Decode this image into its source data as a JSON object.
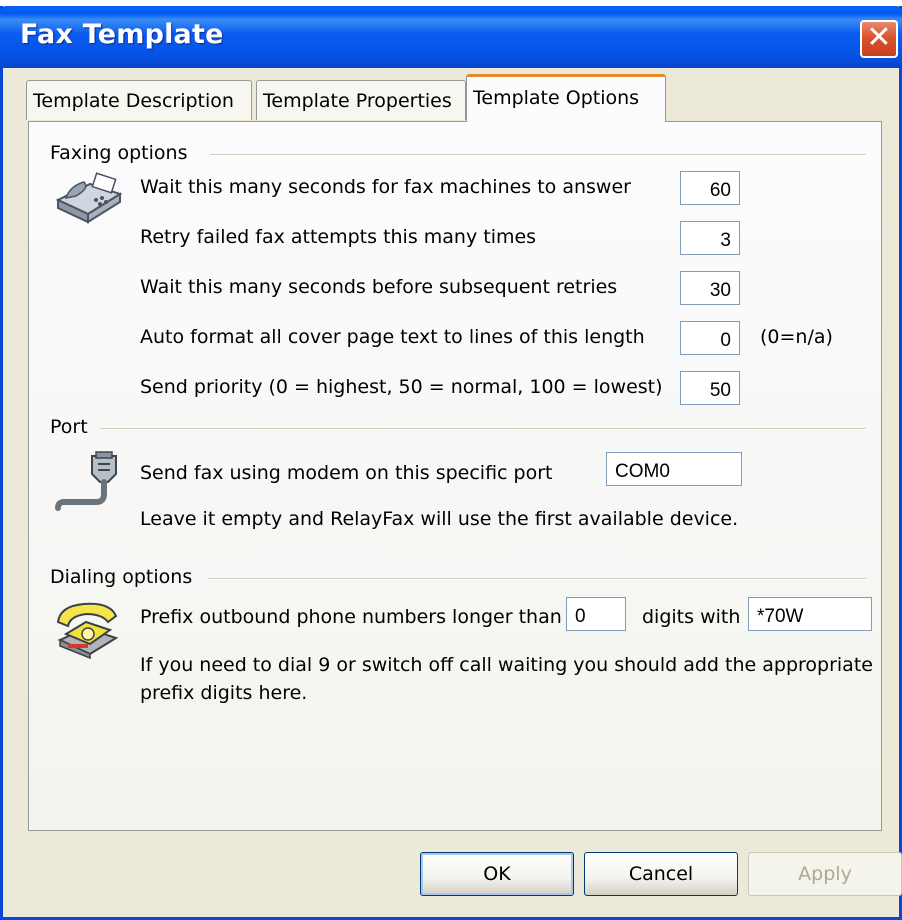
{
  "window": {
    "title": "Fax Template",
    "close_symbol": "✕"
  },
  "tabs": [
    {
      "label": "Template Description",
      "active": false
    },
    {
      "label": "Template Properties",
      "active": false
    },
    {
      "label": "Template Options",
      "active": true
    }
  ],
  "faxing": {
    "title": "Faxing options",
    "icon": "fax-machine-icon",
    "rows": [
      {
        "label": "Wait this many seconds for fax machines to answer",
        "value": "60"
      },
      {
        "label": "Retry failed fax attempts this many times",
        "value": "3"
      },
      {
        "label": "Wait this many seconds before subsequent retries",
        "value": "30"
      },
      {
        "label": "Auto format all cover page text to lines of this length",
        "value": "0",
        "hint": "(0=n/a)"
      },
      {
        "label": "Send priority (0 = highest, 50 = normal, 100 = lowest)",
        "value": "50"
      }
    ]
  },
  "port": {
    "title": "Port",
    "icon": "serial-cable-icon",
    "label": "Send fax using modem on this specific port",
    "value": "COM0",
    "note": "Leave it empty and RelayFax will use the first available device."
  },
  "dialing": {
    "title": "Dialing options",
    "icon": "telephone-icon",
    "prefix_label": "Prefix outbound phone numbers longer than",
    "digits_value": "0",
    "digits_with_label": "digits with",
    "prefix_value": "*70W",
    "note_line1": "If you need to dial 9 or switch off call waiting you should add the appropriate",
    "note_line2": "prefix digits here."
  },
  "buttons": {
    "ok": "OK",
    "cancel": "Cancel",
    "apply": "Apply"
  },
  "colors": {
    "title_bar": "#0553e4",
    "dialog_bg": "#ece9d8",
    "active_tab_accent": "#e68b2c",
    "close_button": "#d9542f"
  }
}
